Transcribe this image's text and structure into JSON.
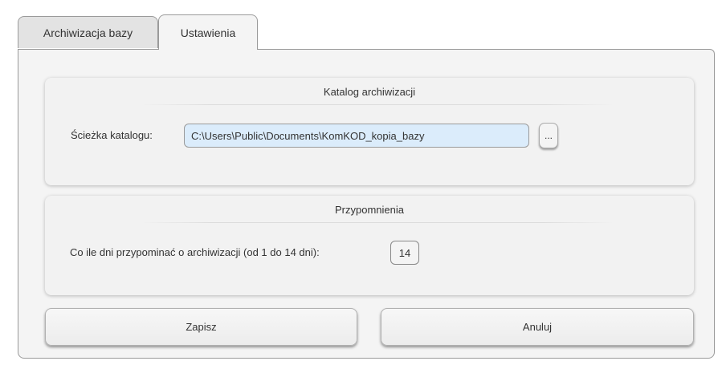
{
  "tabs": [
    {
      "label": "Archiwizacja bazy",
      "active": false
    },
    {
      "label": "Ustawienia",
      "active": true
    }
  ],
  "archive_group": {
    "title": "Katalog archiwizacji",
    "path_label": "Ścieżka katalogu:",
    "path_value": "C:\\Users\\Public\\Documents\\KomKOD_kopia_bazy",
    "browse_label": "..."
  },
  "reminder_group": {
    "title": "Przypomnienia",
    "days_label": "Co ile dni przypominać o archiwizacji (od 1 do 14 dni):",
    "days_value": "14"
  },
  "actions": {
    "save_label": "Zapisz",
    "cancel_label": "Anuluj"
  },
  "colors": {
    "panel_bg": "#f4f4f4",
    "input_highlight": "#dbecfb",
    "border": "#9a9a9a"
  }
}
